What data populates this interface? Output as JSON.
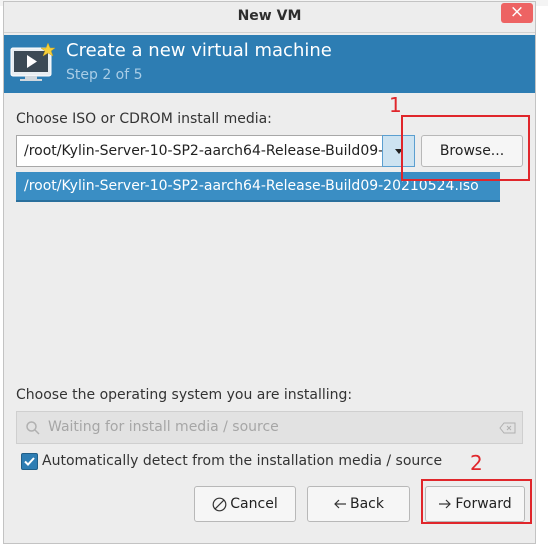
{
  "dialog": {
    "title": "New VM",
    "close_glyph": "×"
  },
  "banner": {
    "title": "Create a new virtual machine",
    "step": "Step 2 of 5",
    "icon": "vm-monitor-icon"
  },
  "install_media": {
    "label": "Choose ISO or CDROM install media:",
    "value": "/root/Kylin-Server-10-SP2-aarch64-Release-Build09-20210524.iso",
    "dropdown_items": [
      "/root/Kylin-Server-10-SP2-aarch64-Release-Build09-20210524.iso"
    ],
    "browse_label": "Browse..."
  },
  "os_select": {
    "label": "Choose the operating system you are installing:",
    "placeholder": "Waiting for install media / source",
    "auto_detect_label": "Automatically detect from the installation media / source",
    "auto_detect_checked": true
  },
  "buttons": {
    "cancel": "Cancel",
    "back": "Back",
    "forward": "Forward"
  },
  "annotations": {
    "marker_1": "1",
    "marker_2": "2",
    "color": "#e0262b"
  },
  "colors": {
    "banner": "#2d7db3",
    "selection": "#3a8ec4",
    "close_button": "#ed6363"
  }
}
